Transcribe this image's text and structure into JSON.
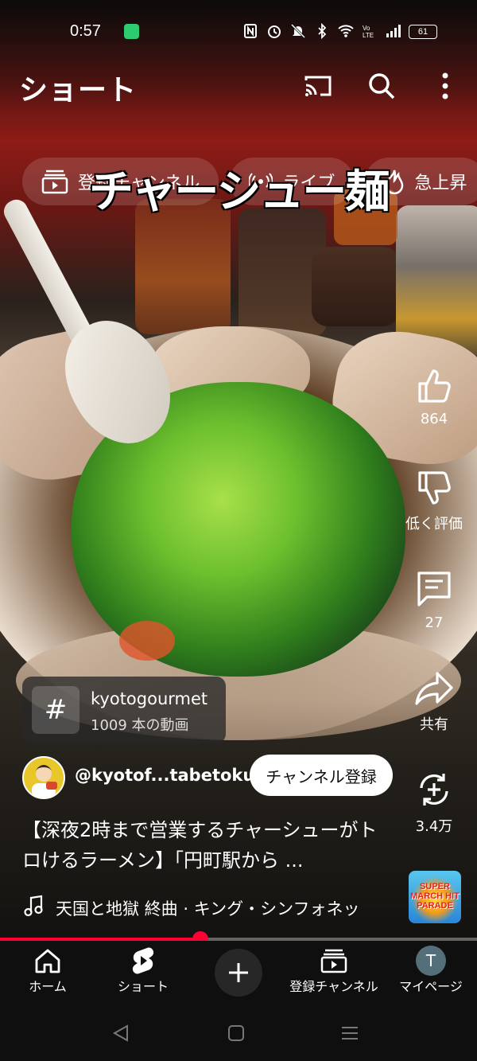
{
  "status_bar": {
    "time": "0:57",
    "battery": "61",
    "icons": [
      "nfc-icon",
      "alarm-icon",
      "mute-icon",
      "bluetooth-icon",
      "wifi-icon",
      "volte-icon",
      "signal-icon"
    ]
  },
  "header": {
    "title": "ショート",
    "actions": [
      "cast-icon",
      "search-icon",
      "more-vert-icon"
    ]
  },
  "chips": [
    {
      "label": "登録チャンネル",
      "icon": "subscriptions-icon"
    },
    {
      "label": "ライブ",
      "icon": "live-icon"
    },
    {
      "label": "急上昇",
      "icon": "trending-icon"
    }
  ],
  "video": {
    "overlay_text": "チャーシュー麺"
  },
  "actions": {
    "like_count": "864",
    "dislike_label": "低く評価",
    "comment_count": "27",
    "share_label": "共有",
    "remix_count": "3.4万"
  },
  "hashtag": {
    "name": "kyotogourmet",
    "count": "1009 本の動画"
  },
  "channel": {
    "handle": "@kyotof...tabetoku",
    "subscribe_label": "チャンネル登録"
  },
  "description": "【深夜2時まで営業するチャーシューがトロけるラーメン】「円町駅から ...",
  "music": {
    "text": "天国と地獄 終曲 · キング・シンフォネッ",
    "thumb_text": "SUPER MARCH HIT PARADE"
  },
  "progress": 0.42,
  "bottom_nav": {
    "home": "ホーム",
    "shorts": "ショート",
    "subscriptions": "登録チャンネル",
    "profile": "マイページ",
    "avatar_letter": "T"
  },
  "colors": {
    "accent": "#ff0033",
    "background": "#0f0f0f",
    "avatar": "#546e7a"
  }
}
